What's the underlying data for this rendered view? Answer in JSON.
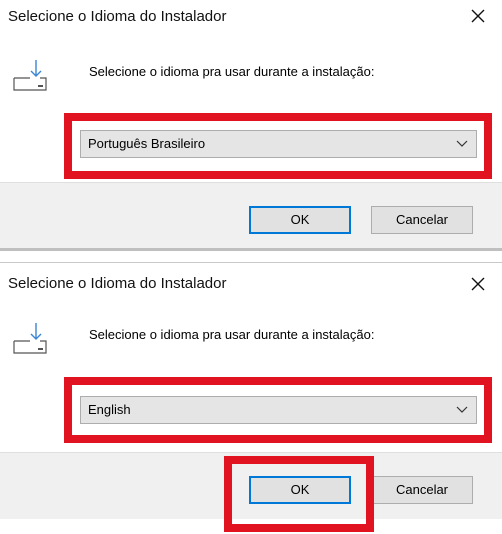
{
  "dialogs": [
    {
      "title": "Selecione o Idioma do Instalador",
      "prompt": "Selecione o idioma pra usar durante a instalação:",
      "language_select": {
        "selected": "Português Brasileiro"
      },
      "buttons": {
        "ok": "OK",
        "cancel": "Cancelar"
      }
    },
    {
      "title": "Selecione o Idioma do Instalador",
      "prompt": "Selecione o idioma pra usar durante a instalação:",
      "language_select": {
        "selected": "English"
      },
      "buttons": {
        "ok": "OK",
        "cancel": "Cancelar"
      }
    }
  ],
  "icons": {
    "close": "close-icon",
    "installer": "install-download-icon",
    "dropdown": "chevron-down-icon"
  },
  "colors": {
    "highlight": "#e11320",
    "ok_border": "#0078d7",
    "footer_bg": "#f0f0f0"
  }
}
